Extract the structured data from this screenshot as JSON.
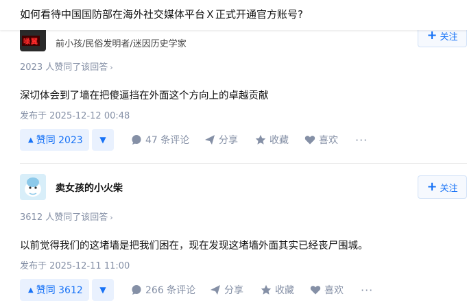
{
  "question": {
    "title": "如何看待中国国防部在海外社交媒体平台Ｘ正式开通官方账号?"
  },
  "answers": [
    {
      "author_bio": "前小孩/民俗发明者/迷因历史学家",
      "avatar_text": "噪翼",
      "follow_label": "关注",
      "vote_summary": "2023 人赞同了该回答",
      "content": "深切体会到了墙在把傻逼挡在外面这个方向上的卓越贡献",
      "published": "发布于 2025-12-12 00:48",
      "vote_label": "赞同 2023",
      "comment_label": "47 条评论",
      "share_label": "分享",
      "favorite_label": "收藏",
      "like_label": "喜欢",
      "more_label": "···"
    },
    {
      "author_name": "卖女孩的小火柴",
      "follow_label": "关注",
      "vote_summary": "3612 人赞同了该回答",
      "content": "以前觉得我们的这堵墙是把我们困在，现在发现这堵墙外面其实已经丧尸围城。",
      "published": "发布于 2025-12-11 11:00",
      "vote_label": "赞同 3612",
      "comment_label": "266 条评论",
      "share_label": "分享",
      "favorite_label": "收藏",
      "like_label": "喜欢",
      "more_label": "···"
    }
  ],
  "colors": {
    "accent": "#1772f6",
    "muted": "#8590a6",
    "vote_bg": "#e9f1fe"
  }
}
